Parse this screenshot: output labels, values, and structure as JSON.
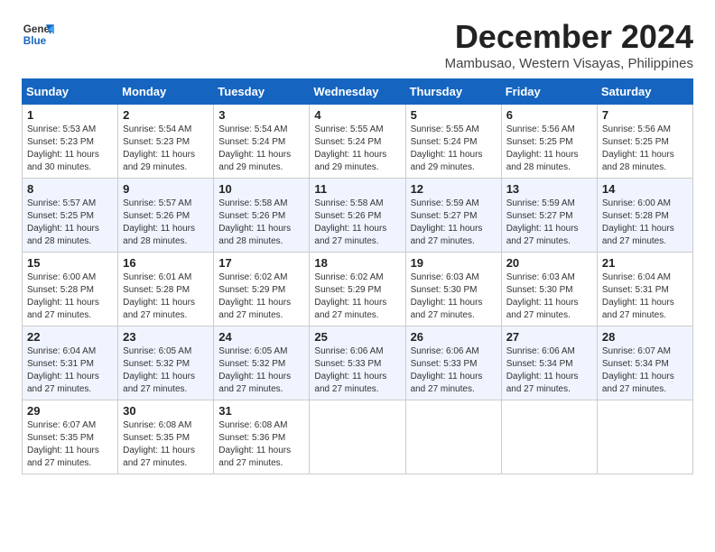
{
  "logo": {
    "line1": "General",
    "line2": "Blue"
  },
  "title": "December 2024",
  "location": "Mambusao, Western Visayas, Philippines",
  "days_of_week": [
    "Sunday",
    "Monday",
    "Tuesday",
    "Wednesday",
    "Thursday",
    "Friday",
    "Saturday"
  ],
  "weeks": [
    [
      {
        "day": "1",
        "info": "Sunrise: 5:53 AM\nSunset: 5:23 PM\nDaylight: 11 hours\nand 30 minutes."
      },
      {
        "day": "2",
        "info": "Sunrise: 5:54 AM\nSunset: 5:23 PM\nDaylight: 11 hours\nand 29 minutes."
      },
      {
        "day": "3",
        "info": "Sunrise: 5:54 AM\nSunset: 5:24 PM\nDaylight: 11 hours\nand 29 minutes."
      },
      {
        "day": "4",
        "info": "Sunrise: 5:55 AM\nSunset: 5:24 PM\nDaylight: 11 hours\nand 29 minutes."
      },
      {
        "day": "5",
        "info": "Sunrise: 5:55 AM\nSunset: 5:24 PM\nDaylight: 11 hours\nand 29 minutes."
      },
      {
        "day": "6",
        "info": "Sunrise: 5:56 AM\nSunset: 5:25 PM\nDaylight: 11 hours\nand 28 minutes."
      },
      {
        "day": "7",
        "info": "Sunrise: 5:56 AM\nSunset: 5:25 PM\nDaylight: 11 hours\nand 28 minutes."
      }
    ],
    [
      {
        "day": "8",
        "info": "Sunrise: 5:57 AM\nSunset: 5:25 PM\nDaylight: 11 hours\nand 28 minutes."
      },
      {
        "day": "9",
        "info": "Sunrise: 5:57 AM\nSunset: 5:26 PM\nDaylight: 11 hours\nand 28 minutes."
      },
      {
        "day": "10",
        "info": "Sunrise: 5:58 AM\nSunset: 5:26 PM\nDaylight: 11 hours\nand 28 minutes."
      },
      {
        "day": "11",
        "info": "Sunrise: 5:58 AM\nSunset: 5:26 PM\nDaylight: 11 hours\nand 27 minutes."
      },
      {
        "day": "12",
        "info": "Sunrise: 5:59 AM\nSunset: 5:27 PM\nDaylight: 11 hours\nand 27 minutes."
      },
      {
        "day": "13",
        "info": "Sunrise: 5:59 AM\nSunset: 5:27 PM\nDaylight: 11 hours\nand 27 minutes."
      },
      {
        "day": "14",
        "info": "Sunrise: 6:00 AM\nSunset: 5:28 PM\nDaylight: 11 hours\nand 27 minutes."
      }
    ],
    [
      {
        "day": "15",
        "info": "Sunrise: 6:00 AM\nSunset: 5:28 PM\nDaylight: 11 hours\nand 27 minutes."
      },
      {
        "day": "16",
        "info": "Sunrise: 6:01 AM\nSunset: 5:28 PM\nDaylight: 11 hours\nand 27 minutes."
      },
      {
        "day": "17",
        "info": "Sunrise: 6:02 AM\nSunset: 5:29 PM\nDaylight: 11 hours\nand 27 minutes."
      },
      {
        "day": "18",
        "info": "Sunrise: 6:02 AM\nSunset: 5:29 PM\nDaylight: 11 hours\nand 27 minutes."
      },
      {
        "day": "19",
        "info": "Sunrise: 6:03 AM\nSunset: 5:30 PM\nDaylight: 11 hours\nand 27 minutes."
      },
      {
        "day": "20",
        "info": "Sunrise: 6:03 AM\nSunset: 5:30 PM\nDaylight: 11 hours\nand 27 minutes."
      },
      {
        "day": "21",
        "info": "Sunrise: 6:04 AM\nSunset: 5:31 PM\nDaylight: 11 hours\nand 27 minutes."
      }
    ],
    [
      {
        "day": "22",
        "info": "Sunrise: 6:04 AM\nSunset: 5:31 PM\nDaylight: 11 hours\nand 27 minutes."
      },
      {
        "day": "23",
        "info": "Sunrise: 6:05 AM\nSunset: 5:32 PM\nDaylight: 11 hours\nand 27 minutes."
      },
      {
        "day": "24",
        "info": "Sunrise: 6:05 AM\nSunset: 5:32 PM\nDaylight: 11 hours\nand 27 minutes."
      },
      {
        "day": "25",
        "info": "Sunrise: 6:06 AM\nSunset: 5:33 PM\nDaylight: 11 hours\nand 27 minutes."
      },
      {
        "day": "26",
        "info": "Sunrise: 6:06 AM\nSunset: 5:33 PM\nDaylight: 11 hours\nand 27 minutes."
      },
      {
        "day": "27",
        "info": "Sunrise: 6:06 AM\nSunset: 5:34 PM\nDaylight: 11 hours\nand 27 minutes."
      },
      {
        "day": "28",
        "info": "Sunrise: 6:07 AM\nSunset: 5:34 PM\nDaylight: 11 hours\nand 27 minutes."
      }
    ],
    [
      {
        "day": "29",
        "info": "Sunrise: 6:07 AM\nSunset: 5:35 PM\nDaylight: 11 hours\nand 27 minutes."
      },
      {
        "day": "30",
        "info": "Sunrise: 6:08 AM\nSunset: 5:35 PM\nDaylight: 11 hours\nand 27 minutes."
      },
      {
        "day": "31",
        "info": "Sunrise: 6:08 AM\nSunset: 5:36 PM\nDaylight: 11 hours\nand 27 minutes."
      },
      {
        "day": "",
        "info": ""
      },
      {
        "day": "",
        "info": ""
      },
      {
        "day": "",
        "info": ""
      },
      {
        "day": "",
        "info": ""
      }
    ]
  ]
}
